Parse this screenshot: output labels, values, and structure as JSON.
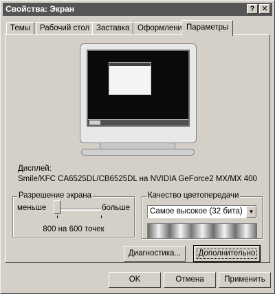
{
  "window": {
    "title": "Свойства: Экран",
    "help_glyph": "?",
    "close_glyph": "✕"
  },
  "tabs": [
    {
      "label": "Темы"
    },
    {
      "label": "Рабочий стол"
    },
    {
      "label": "Заставка"
    },
    {
      "label": "Оформление"
    },
    {
      "label": "Параметры",
      "active": true
    }
  ],
  "display": {
    "label": "Дисплей:",
    "value": "Smile/KFC CA6525DL/CB6525DL на NVIDIA GeForce2 MX/MX 400"
  },
  "resolution": {
    "group_title": "Разрешение экрана",
    "less_label": "меньше",
    "more_label": "больше",
    "value_text": "800 на 600 точек",
    "slider_fraction": 0.0
  },
  "color_quality": {
    "group_title": "Качество цветопередачи",
    "selected": "Самое высокое (32 бита)",
    "dropdown_glyph": "▼"
  },
  "buttons": {
    "diagnostics": "Диагностика...",
    "advanced": "Дополнительно",
    "ok": "OK",
    "cancel": "Отмена",
    "apply": "Применить"
  },
  "colors": {
    "titlebar": "#555555",
    "face": "#d4d0c8"
  }
}
